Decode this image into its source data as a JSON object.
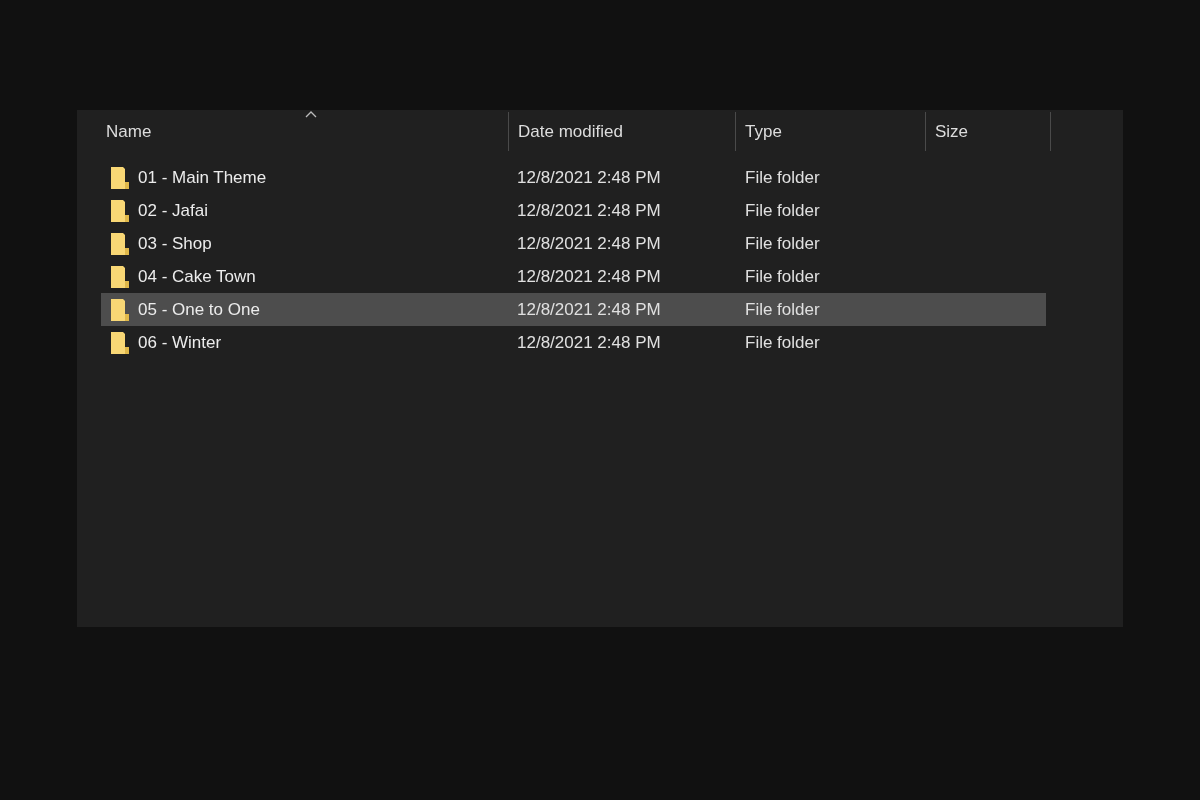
{
  "table": {
    "columns": [
      {
        "label": "Name",
        "sorted": true
      },
      {
        "label": "Date modified",
        "sorted": false
      },
      {
        "label": "Type",
        "sorted": false
      },
      {
        "label": "Size",
        "sorted": false
      }
    ],
    "rows": [
      {
        "name": "01 - Main Theme",
        "date": "12/8/2021 2:48 PM",
        "type": "File folder",
        "selected": false
      },
      {
        "name": "02 - Jafai",
        "date": "12/8/2021 2:48 PM",
        "type": "File folder",
        "selected": false
      },
      {
        "name": "03 - Shop",
        "date": "12/8/2021 2:48 PM",
        "type": "File folder",
        "selected": false
      },
      {
        "name": "04 - Cake Town",
        "date": "12/8/2021 2:48 PM",
        "type": "File folder",
        "selected": false
      },
      {
        "name": "05 - One to One",
        "date": "12/8/2021 2:48 PM",
        "type": "File folder",
        "selected": true
      },
      {
        "name": "06 - Winter",
        "date": "12/8/2021 2:48 PM",
        "type": "File folder",
        "selected": false
      }
    ]
  }
}
